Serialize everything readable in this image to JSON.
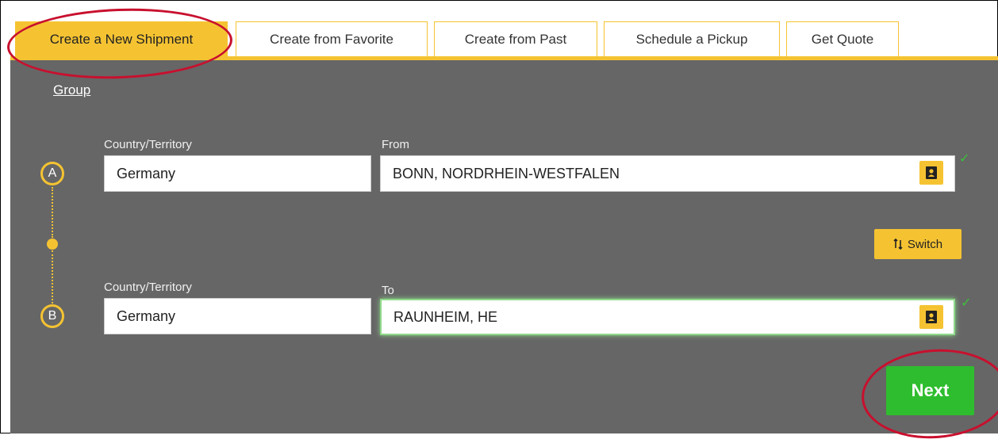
{
  "tabs": [
    {
      "label": "Create a New Shipment",
      "active": true
    },
    {
      "label": "Create from Favorite",
      "active": false
    },
    {
      "label": "Create from Past",
      "active": false
    },
    {
      "label": "Schedule a Pickup",
      "active": false
    },
    {
      "label": "Get Quote",
      "active": false
    }
  ],
  "group_link": "Group",
  "origin": {
    "marker": "A",
    "country_label": "Country/Territory",
    "country_value": "Germany",
    "city_label": "From",
    "city_value": "BONN, NORDRHEIN-WESTFALEN",
    "check": "✓"
  },
  "destination": {
    "marker": "B",
    "country_label": "Country/Territory",
    "country_value": "Germany",
    "city_label": "To",
    "city_value": "RAUNHEIM, HE",
    "check": "✓"
  },
  "switch_label": "Switch",
  "next_label": "Next",
  "colors": {
    "accent": "#f5c332",
    "panel": "#666666",
    "next": "#2ebd2e",
    "annotation": "#c8102e"
  },
  "icons": {
    "contact": "address-book-icon",
    "switch": "swap-vertical-icon",
    "check": "check-icon"
  }
}
